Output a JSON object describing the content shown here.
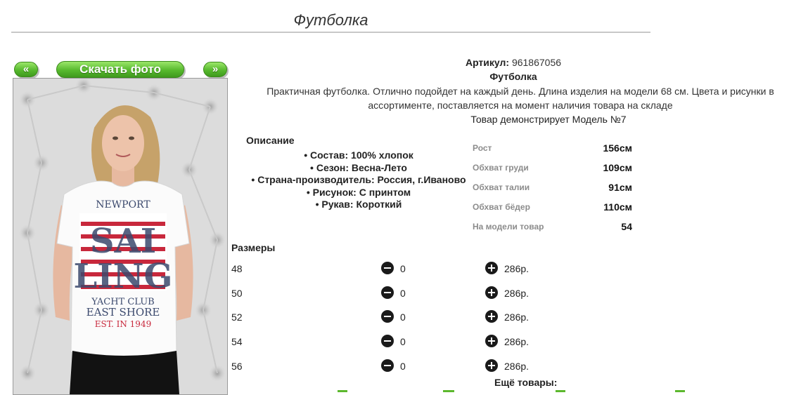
{
  "page": {
    "title": "Футболка"
  },
  "gallery": {
    "prev_label": "«",
    "download_label": "Скачать фото",
    "next_label": "»",
    "photo_print_text": [
      "NEWPORT",
      "SAILING",
      "YACHT CLUB",
      "EAST SHORE",
      "EST. IN 1949"
    ]
  },
  "product": {
    "sku_label": "Артикул:",
    "sku_value": "961867056",
    "name": "Футболка",
    "description": "Практичная футболка. Отлично подойдет на каждый день. Длина изделия на модели 68 см. Цвета и рисунки в ассортименте, поставляется на момент наличия товара на складе",
    "model_note": "Товар демонстрирует Модель №7"
  },
  "details": {
    "heading": "Описание",
    "items": [
      "Состав: 100% хлопок",
      "Сезон: Весна-Лето",
      "Страна-производитель: Россия, г.Иваново",
      "Рисунок: С принтом",
      "Рукав: Короткий"
    ]
  },
  "model_params": [
    {
      "label": "Рост",
      "value": "156см"
    },
    {
      "label": "Обхват груди",
      "value": "109см"
    },
    {
      "label": "Обхват талии",
      "value": "91см"
    },
    {
      "label": "Обхват бёдер",
      "value": "110см"
    },
    {
      "label": "На модели товар",
      "value": "54"
    }
  ],
  "sizes": {
    "heading": "Размеры",
    "rows": [
      {
        "size": "48",
        "qty": "0",
        "price": "286р."
      },
      {
        "size": "50",
        "qty": "0",
        "price": "286р."
      },
      {
        "size": "52",
        "qty": "0",
        "price": "286р."
      },
      {
        "size": "54",
        "qty": "0",
        "price": "286р."
      },
      {
        "size": "56",
        "qty": "0",
        "price": "286р."
      }
    ]
  },
  "more": {
    "heading": "Ещё товары:"
  },
  "colors": {
    "button_green": "#57b92e",
    "link_green": "#5cb82e",
    "print_red": "#c8283c",
    "print_navy": "#3c4a6e"
  }
}
